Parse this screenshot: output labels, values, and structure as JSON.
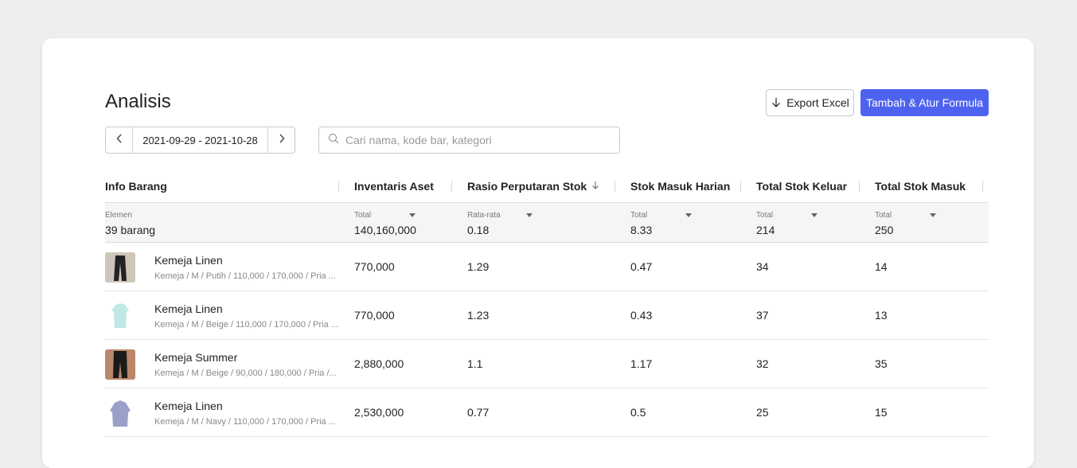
{
  "page": {
    "title": "Analisis",
    "export_label": "Export Excel",
    "formula_label": "Tambah & Atur Formula",
    "date_range": "2021-09-29 - 2021-10-28",
    "search_placeholder": "Cari nama, kode bar, kategori"
  },
  "table": {
    "columns": [
      "Info Barang",
      "Inventaris Aset",
      "Rasio Perputaran Stok",
      "Stok Masuk Harian",
      "Total Stok Keluar",
      "Total Stok Masuk"
    ],
    "summary": [
      {
        "label": "Elemen",
        "value": "39 barang"
      },
      {
        "label": "Total",
        "value": "140,160,000"
      },
      {
        "label": "Rata-rata",
        "value": "0.18"
      },
      {
        "label": "Total",
        "value": "8.33"
      },
      {
        "label": "Total",
        "value": "214"
      },
      {
        "label": "Total",
        "value": "250"
      }
    ],
    "rows": [
      {
        "name": "Kemeja Linen",
        "desc": "Kemeja / M / Putih / 110,000 / 170,000 / Pria ...",
        "asset": "770,000",
        "ratio": "1.29",
        "daily_in": "0.47",
        "out": "34",
        "in": "14"
      },
      {
        "name": "Kemeja Linen",
        "desc": "Kemeja / M / Beige / 110,000 / 170,000 / Pria ...",
        "asset": "770,000",
        "ratio": "1.23",
        "daily_in": "0.43",
        "out": "37",
        "in": "13"
      },
      {
        "name": "Kemeja Summer",
        "desc": "Kemeja / M / Beige / 90,000 / 180,000 / Pria /...",
        "asset": "2,880,000",
        "ratio": "1.1",
        "daily_in": "1.17",
        "out": "32",
        "in": "35"
      },
      {
        "name": "Kemeja Linen",
        "desc": "Kemeja / M / Navy / 110,000 / 170,000 / Pria ...",
        "asset": "2,530,000",
        "ratio": "0.77",
        "daily_in": "0.5",
        "out": "25",
        "in": "15"
      }
    ]
  },
  "colors": {
    "accent": "#4d63f0",
    "background": "#eeeeef"
  },
  "icons": {
    "export": "arrow-down-icon",
    "sort": "sort-arrow-down-icon",
    "search": "search-icon",
    "prev": "chevron-left-icon",
    "next": "chevron-right-icon"
  }
}
